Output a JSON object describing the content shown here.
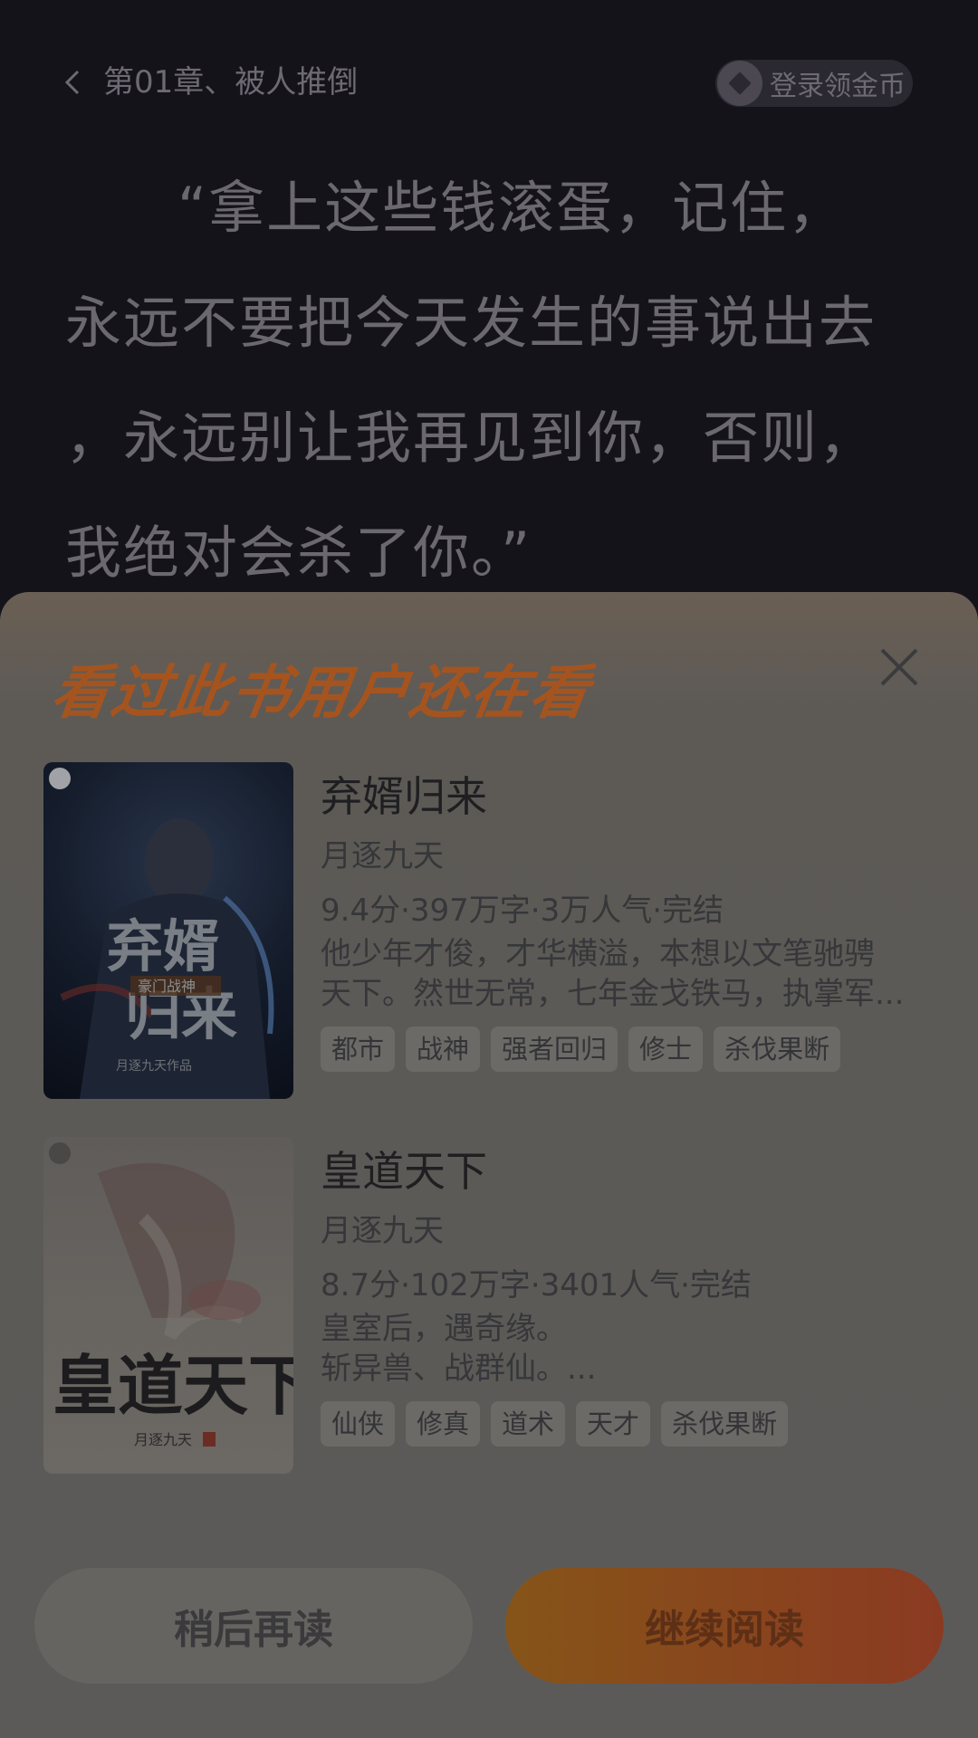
{
  "reader": {
    "chapter_title": "第01章、被人推倒",
    "coin_label": "登录领金币",
    "paragraph_lines": [
      "“拿上这些钱滚蛋，记住，",
      "永远不要把今天发生的事说出去",
      "，永远别让我再见到你，否则，",
      "我绝对会杀了你。”"
    ]
  },
  "sheet": {
    "title": "看过此书用户还在看",
    "books": [
      {
        "title": "弃婿归来",
        "author": "月逐九天",
        "meta": "9.4分·397万字·3万人气·完结",
        "desc_lines": [
          "他少年才俊，才华横溢，本想以文笔驰骋",
          "天下。然世无常，七年金戈铁马，执掌军..."
        ],
        "tags": [
          "都市",
          "战神",
          "强者回归",
          "修士",
          "杀伐果断"
        ]
      },
      {
        "title": "皇道天下",
        "author": "月逐九天",
        "meta": "8.7分·102万字·3401人气·完结",
        "desc_lines": [
          "皇室后，遇奇缘。",
          "斩异兽、战群仙。..."
        ],
        "tags": [
          "仙侠",
          "修真",
          "道术",
          "天才",
          "杀伐果断"
        ]
      }
    ],
    "buttons": {
      "later": "稍后再读",
      "continue": "继续阅读"
    }
  }
}
